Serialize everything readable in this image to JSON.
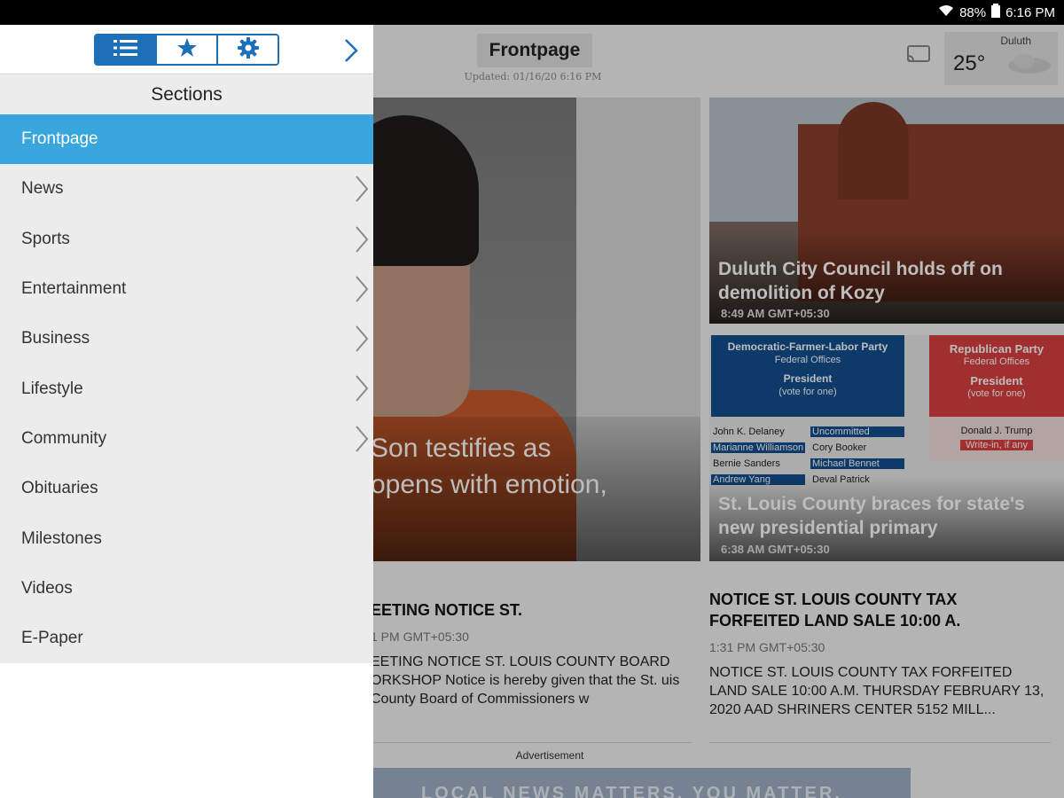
{
  "status_bar": {
    "battery": "88%",
    "time": "6:16 PM"
  },
  "header": {
    "title": "Frontpage",
    "updated": "Updated: 01/16/20 6:16 PM"
  },
  "weather": {
    "city": "Duluth",
    "temp": "25°"
  },
  "stories": [
    {
      "headline_line1": "Son testifies as",
      "headline_line2": "opens with emotion,"
    },
    {
      "headline": "Duluth City Council holds off on demolition of Kozy",
      "time": "8:49 AM GMT+05:30"
    },
    {
      "headline": "St. Louis County braces for state's new presidential primary",
      "time": "6:38 AM GMT+05:30"
    }
  ],
  "ballot": {
    "dem_party": "Democratic-Farmer-Labor Party",
    "dem_offices": "Federal Offices",
    "president": "President",
    "vote_for_one": "(vote for one)",
    "dem_candidates": [
      [
        "John K. Delaney",
        "Uncommitted"
      ],
      [
        "Marianne Williamson",
        "Cory Booker"
      ],
      [
        "Bernie Sanders",
        "Michael Bennet"
      ],
      [
        "Andrew Yang",
        "Deval Patrick"
      ]
    ],
    "rep_party": "Republican Party",
    "rep_offices": "Federal Offices",
    "rep_candidate": "Donald J. Trump",
    "write_in": "Write-in, if any"
  },
  "articles": [
    {
      "headline": "EETING NOTICE ST.",
      "time": "1 PM GMT+05:30",
      "body": "EETING NOTICE ST. LOUIS COUNTY BOARD ORKSHOP Notice is hereby given that the St. uis County Board of Commissioners w"
    },
    {
      "headline": "NOTICE ST. LOUIS COUNTY TAX FORFEITED LAND SALE 10:00 A.",
      "time": "1:31 PM GMT+05:30",
      "body": "NOTICE ST. LOUIS COUNTY TAX FORFEITED LAND SALE 10:00 A.M. THURSDAY FEBRUARY 13, 2020 AAD SHRINERS CENTER 5152 MILL..."
    }
  ],
  "advertisement": {
    "label": "Advertisement",
    "text": "LOCAL NEWS MATTERS. YOU MATTER."
  },
  "drawer": {
    "sections_title": "Sections",
    "items": [
      {
        "label": "Frontpage",
        "active": true,
        "has_children": false
      },
      {
        "label": "News",
        "has_children": true
      },
      {
        "label": "Sports",
        "has_children": true
      },
      {
        "label": "Entertainment",
        "has_children": true
      },
      {
        "label": "Business",
        "has_children": true
      },
      {
        "label": "Lifestyle",
        "has_children": true
      },
      {
        "label": "Community",
        "has_children": true
      },
      {
        "label": "Obituaries",
        "has_children": false
      },
      {
        "label": "Milestones",
        "has_children": false
      },
      {
        "label": "Videos",
        "has_children": false
      },
      {
        "label": "E-Paper",
        "has_children": false
      }
    ],
    "tabs": [
      {
        "icon": "list-icon",
        "active": true
      },
      {
        "icon": "star-icon",
        "active": false
      },
      {
        "icon": "gear-icon",
        "active": false
      }
    ]
  },
  "colors": {
    "accent": "#1d6fb8",
    "active_item": "#3aa6de",
    "drawer_bg": "#ececec"
  }
}
